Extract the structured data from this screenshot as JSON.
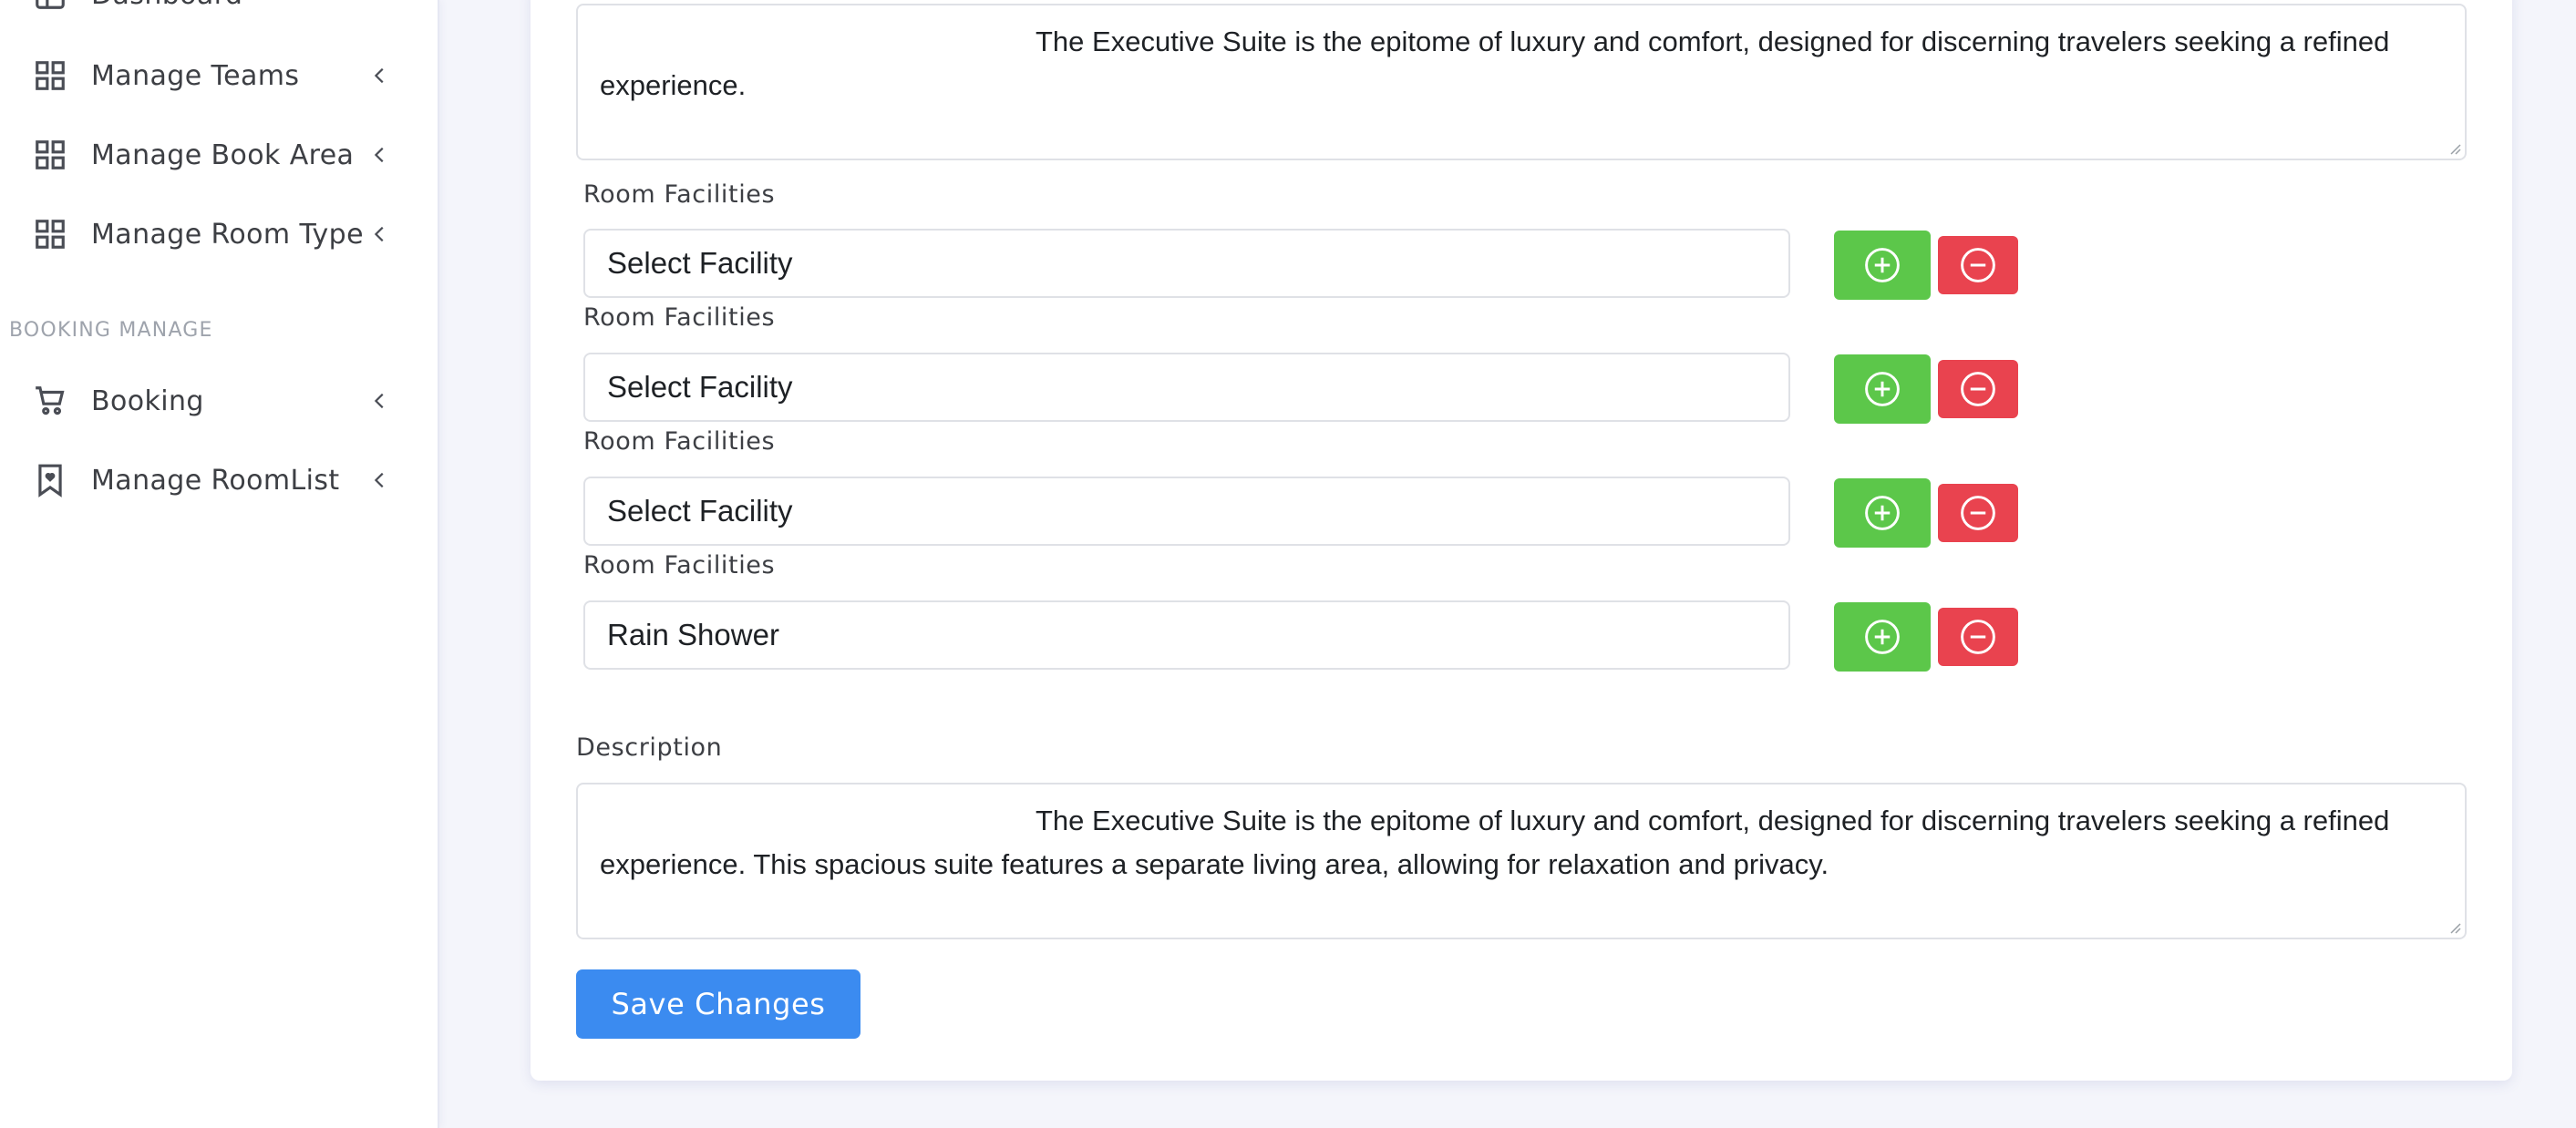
{
  "sidebar": {
    "items": [
      {
        "label": "Dashboard",
        "icon": "dashboard-icon"
      },
      {
        "label": "Manage Teams",
        "icon": "grid-icon"
      },
      {
        "label": "Manage Book Area",
        "icon": "grid-icon"
      },
      {
        "label": "Manage Room Type",
        "icon": "grid-icon"
      },
      {
        "label": "Booking",
        "icon": "cart-icon"
      },
      {
        "label": "Manage RoomList",
        "icon": "bookmark-heart-icon"
      }
    ],
    "section_booking": "BOOKING MANAGE"
  },
  "form": {
    "short_description": "The Executive Suite is the epitome of luxury and comfort, designed for discerning travelers seeking a refined experience.",
    "facilities": [
      {
        "label": "Room Facilities",
        "value": "Select Facility"
      },
      {
        "label": "Room Facilities",
        "value": "Select Facility"
      },
      {
        "label": "Room Facilities",
        "value": "Select Facility"
      },
      {
        "label": "Room Facilities",
        "value": "Rain Shower"
      }
    ],
    "description_label": "Description",
    "description": "The Executive Suite is the epitome of luxury and comfort, designed for discerning travelers seeking a refined experience. This spacious suite features a separate living area, allowing for relaxation and privacy.",
    "save_label": "Save Changes"
  },
  "colors": {
    "add_button": "#5cc74a",
    "remove_button": "#e9434f",
    "save_button": "#3b8bf0"
  }
}
